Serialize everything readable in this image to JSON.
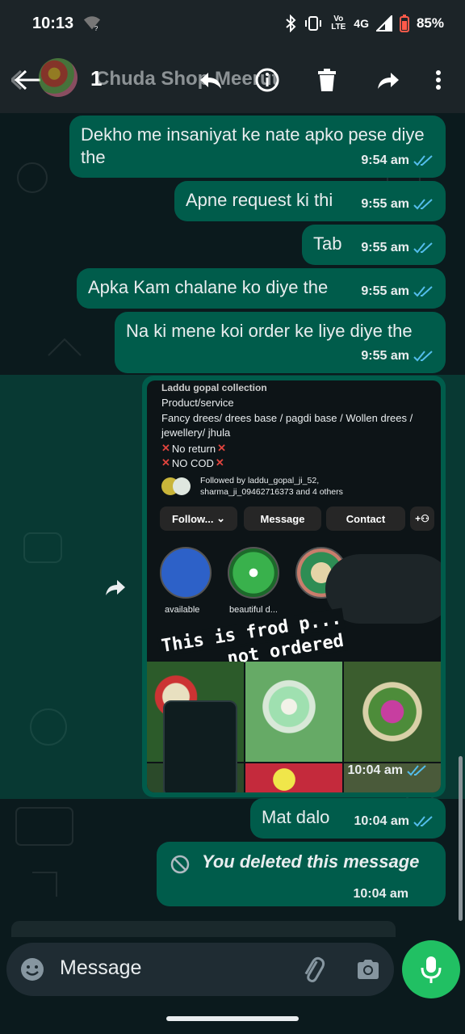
{
  "status_bar": {
    "time": "10:13",
    "wifi_badge": "?",
    "network": "4G",
    "volte": "Vo LTE",
    "battery": "85%"
  },
  "app_bar": {
    "selected_count": "1",
    "contact_name": "Chuda Shop Meerut"
  },
  "messages": [
    {
      "text": "Dekho me insaniyat ke nate apko pese diye the",
      "time": "9:54 am"
    },
    {
      "text": "Apne request ki thi",
      "time": "9:55 am"
    },
    {
      "text": "Tab",
      "time": "9:55 am"
    },
    {
      "text": "Apka Kam chalane ko diye the",
      "time": "9:55 am"
    },
    {
      "text": "Na ki mene koi order ke liye diye the",
      "time": "9:55 am"
    }
  ],
  "image_message": {
    "time": "10:04 am",
    "profile": {
      "line1": "Laddu gopal collection",
      "category": "Product/service",
      "bio": "Fancy drees/ drees base / pagdi base / Wollen drees / jewellery/ jhula",
      "no_return": "No return",
      "no_cod": "NO COD",
      "followed_by_1": "Followed by laddu_gopal_ji_52,",
      "followed_by_2": "sharma_ji_09462716373 and 4 others",
      "follow_btn": "Follow...",
      "message_btn": "Message",
      "contact_btn": "Contact",
      "highlight_1": "available",
      "highlight_2": "beautiful d..."
    },
    "sticker_line1": "This is frod p...",
    "sticker_line2": "not ordered"
  },
  "message_after": {
    "text": "Mat dalo",
    "time": "10:04 am"
  },
  "deleted_message": {
    "text": "You deleted this message",
    "time": "10:04 am"
  },
  "composer": {
    "placeholder": "Message"
  },
  "colors": {
    "bubble_out": "#005c4b",
    "tick_read": "#53bdeb",
    "mic_button": "#21c063",
    "composer_bg": "#1f2c33"
  },
  "icons": [
    "back-arrow-icon",
    "reply-icon",
    "info-icon",
    "delete-icon",
    "forward-icon",
    "more-vert-icon",
    "emoji-icon",
    "attach-icon",
    "camera-icon",
    "mic-icon",
    "blocked-icon",
    "double-tick-icon"
  ]
}
